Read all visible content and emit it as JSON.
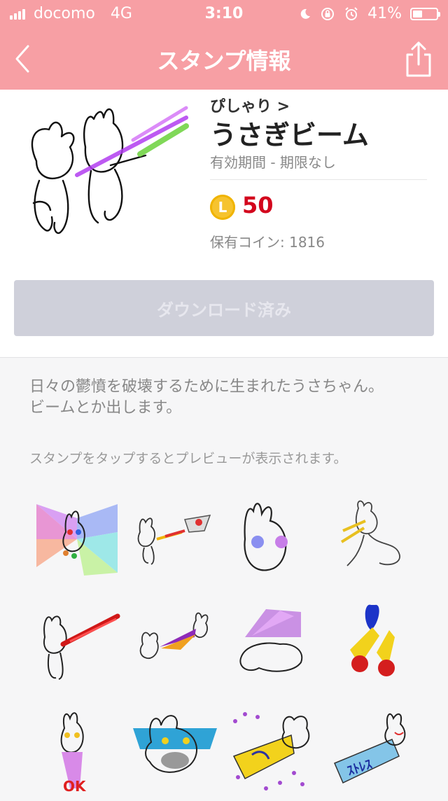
{
  "status_bar": {
    "carrier": "docomo",
    "network": "4G",
    "time": "3:10",
    "battery": "41%",
    "battery_level": 0.41
  },
  "nav": {
    "title": "スタンプ情報",
    "back_icon": "chevron-left-icon",
    "share_icon": "share-icon"
  },
  "product": {
    "author": "ぴしゃり >",
    "title": "うさぎビーム",
    "validity": "有効期間 - 期限なし",
    "coin_letter": "L",
    "price": "50",
    "balance_label": "保有コイン: 1816",
    "download_label": "ダウンロード済み"
  },
  "description": {
    "line1": "日々の鬱憤を破壊するために生まれたうさちゃん。",
    "line2": "ビームとか出します。",
    "hint": "スタンプをタップするとプレビューが表示されます。"
  },
  "colors": {
    "header_bg": "#f79fa4",
    "price": "#d3061d",
    "coin": "#f6c32f",
    "download_disabled_bg": "#cfd0da"
  }
}
